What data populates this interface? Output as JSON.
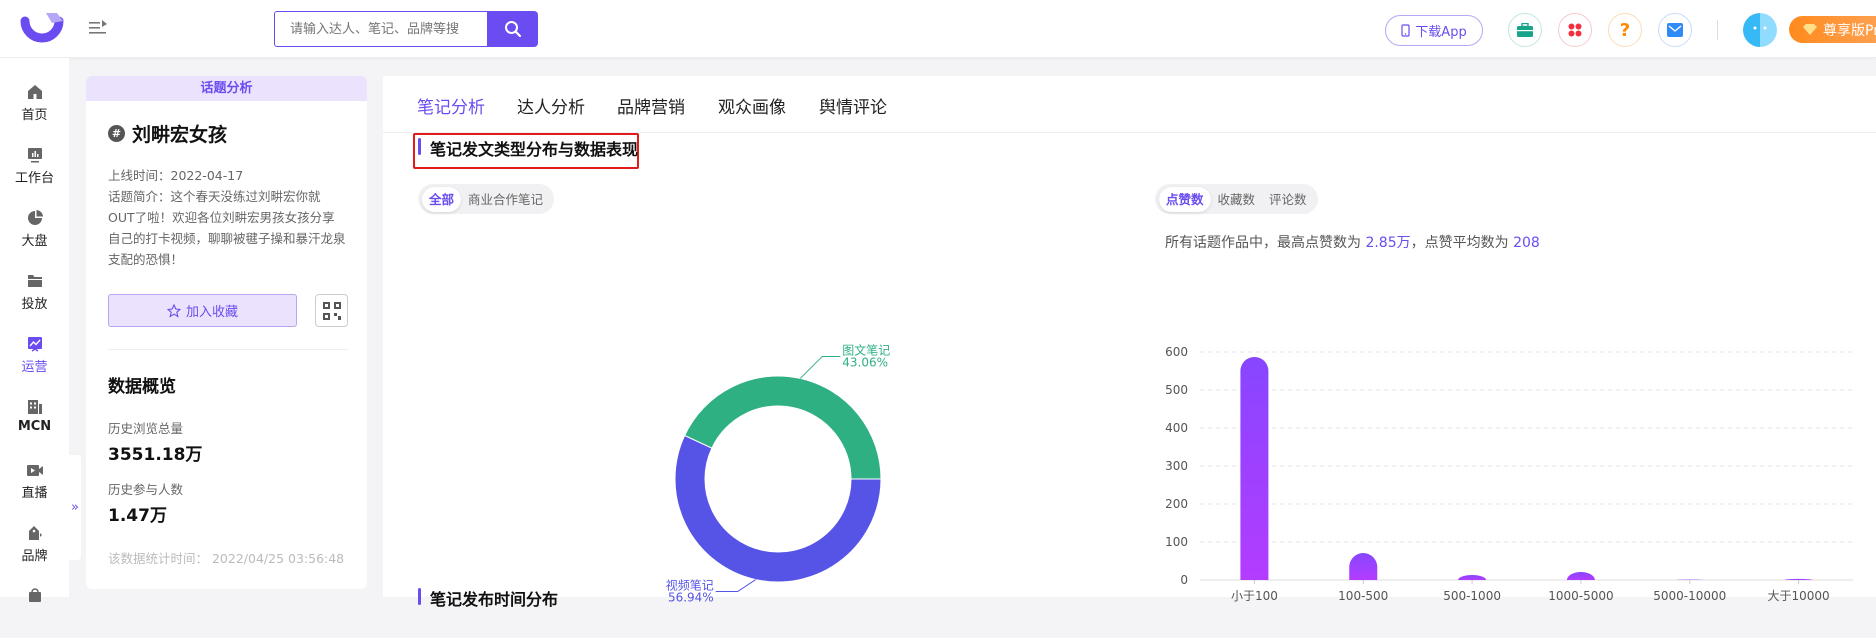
{
  "header": {
    "search_placeholder": "请输入达人、笔记、品牌等搜",
    "download_label": "下载App",
    "pro_label": "尊享版Pro",
    "icons": [
      "toolbox-icon",
      "apps-icon",
      "help-icon",
      "mail-icon"
    ]
  },
  "sidenav": {
    "items": [
      {
        "label": "首页",
        "icon": "home-icon"
      },
      {
        "label": "工作台",
        "icon": "workbench-icon"
      },
      {
        "label": "大盘",
        "icon": "pie-icon"
      },
      {
        "label": "投放",
        "icon": "folder-icon"
      },
      {
        "label": "运营",
        "icon": "trend-icon",
        "active": true
      },
      {
        "label": "MCN",
        "icon": "building-icon"
      },
      {
        "label": "直播",
        "icon": "video-icon"
      },
      {
        "label": "品牌",
        "icon": "tag-icon"
      }
    ],
    "expand_label": "»"
  },
  "info_card": {
    "header": "话题分析",
    "topic_name": "刘畊宏女孩",
    "online_time": "上线时间：2022-04-17",
    "intro_lines": [
      "话题简介：这个春天没练过刘畊宏你就",
      "OUT了啦！欢迎各位刘畊宏男孩女孩分享",
      "自己的打卡视频，聊聊被毽子操和暴汗龙泉",
      "支配的恐惧！"
    ],
    "favorite_label": "加入收藏",
    "overview_title": "数据概览",
    "views_label": "历史浏览总量",
    "views_value": "3551.18万",
    "participants_label": "历史参与人数",
    "participants_value": "1.47万",
    "stat_time": "该数据统计时间： 2022/04/25 03:56:48"
  },
  "main": {
    "tabs": [
      "笔记分析",
      "达人分析",
      "品牌营销",
      "观众画像",
      "舆情评论"
    ],
    "active_tab": 0,
    "section1_title": "笔记发文类型分布与数据表现",
    "section2_title": "笔记发布时间分布",
    "left_filter": [
      "全部",
      "商业合作笔记"
    ],
    "right_filter": [
      "点赞数",
      "收藏数",
      "评论数"
    ],
    "summary_prefix": "所有话题作品中，最高点赞数为 ",
    "summary_max": "2.85万",
    "summary_mid": "，点赞平均数为 ",
    "summary_avg": "208"
  },
  "chart_data": [
    {
      "type": "pie",
      "variant": "donut",
      "title": "",
      "slices": [
        {
          "label": "图文笔记",
          "value": 43.06,
          "display": "43.06%",
          "color": "#2fb083"
        },
        {
          "label": "视频笔记",
          "value": 56.94,
          "display": "56.94%",
          "color": "#5654e6"
        }
      ]
    },
    {
      "type": "bar",
      "title": "",
      "xlabel": "",
      "ylabel": "",
      "categories": [
        "小于100",
        "100-500",
        "500-1000",
        "1000-5000",
        "5000-10000",
        "大于10000"
      ],
      "values": [
        587,
        71,
        13,
        21,
        1,
        3
      ],
      "ylim": [
        0,
        600
      ],
      "yticks": [
        0,
        100,
        200,
        300,
        400,
        500,
        600
      ],
      "grid": true,
      "colors": [
        "#8846ff",
        "#b33cff"
      ]
    }
  ]
}
